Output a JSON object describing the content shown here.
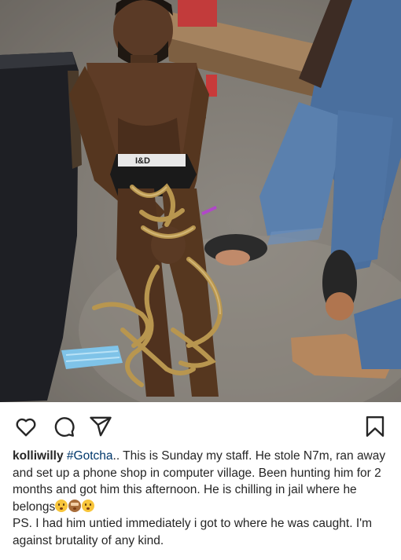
{
  "post": {
    "photo_alt": "Photo of a man seated on the ground with rope around his legs and wrists",
    "brief_logo": "I&D"
  },
  "actions": {
    "like": "heart-icon",
    "comment": "comment-icon",
    "share": "share-icon",
    "save": "bookmark-icon"
  },
  "caption": {
    "username": "kolliwilly",
    "hashtag": "#Gotcha",
    "line1": ".. This is Sunday my staff. He stole N7m, ran away and set up a phone shop in computer village. Been hunting him for 2 months and got him this afternoon. He is chilling in jail where he belongs",
    "emojis": [
      "flushed-face",
      "see-no-evil-monkey",
      "flushed-face"
    ],
    "line2": "PS. I had him untied immediately i got to where he was caught. I'm against brutality of any kind."
  },
  "colors": {
    "hashtag": "#00376b",
    "text": "#262626",
    "emoji": "#f8c53a"
  }
}
